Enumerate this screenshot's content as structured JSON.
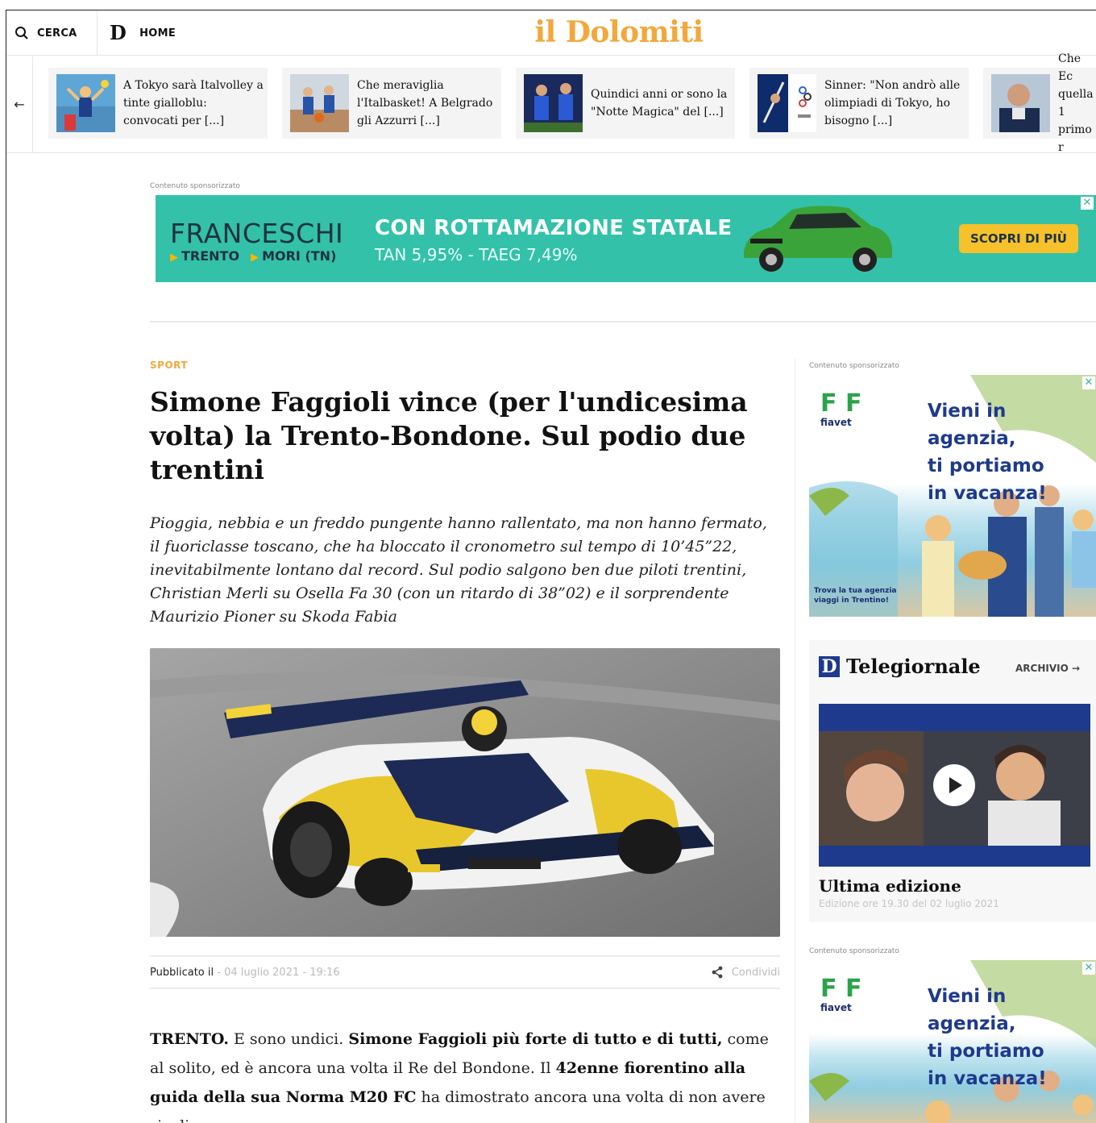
{
  "header": {
    "search_label": "CERCA",
    "home_logo": "D",
    "home_label": "HOME",
    "brand": "il Dolomiti",
    "icons": [
      "search-icon",
      "logo-d-icon"
    ]
  },
  "news_strip": {
    "back_icon": "←",
    "items": [
      {
        "text": "A Tokyo sarà Italvolley a tinte gialloblu: convocati per [...]"
      },
      {
        "text": "Che meraviglia l'Italbasket! A Belgrado gli Azzurri [...]"
      },
      {
        "text": "Quindici anni or sono la \"Notte Magica\" del [...]"
      },
      {
        "text": "Sinner: \"Non andrò alle olimpiadi di Tokyo, ho bisogno [...]"
      },
      {
        "text": "Che Ec quella 1 primo r"
      }
    ]
  },
  "banner_ad": {
    "label": "Contenuto sponsorizzato",
    "brand": "FRANCESCHI",
    "locations": [
      "TRENTO",
      "MORI (TN)"
    ],
    "headline": "CON ROTTAMAZIONE STATALE",
    "subline": "TAN 5,95% - TAEG 7,49%",
    "cta": "SCOPRI DI PIÙ",
    "close": "✕"
  },
  "article": {
    "category": "SPORT",
    "title": "Simone Faggioli vince (per l'undicesima volta) la Trento-Bondone. Sul podio due trentini",
    "lead": "Pioggia, nebbia e un freddo pungente hanno rallentato, ma non hanno fermato, il fuoriclasse toscano, che ha bloccato il cronometro sul tempo di 10’45”22, inevitabilmente lontano dal record. Sul podio salgono ben due piloti trentini, Christian Merli su Osella Fa 30 (con un ritardo di 38”02) e il sorprendente Maurizio Pioner su Skoda Fabia",
    "published_label": "Pubblicato il",
    "published_date": "- 04 luglio 2021 - 19:16",
    "share_label": "Condividi",
    "body": {
      "p1": "TRENTO.",
      "p2": " E sono undici. ",
      "p3": "Simone Faggioli più forte di tutto e di tutti,",
      "p4": " come al solito, ed è ancora una volta il Re del Bondone. Il ",
      "p5": "42enne fiorentino alla guida della sua Norma M20 FC",
      "p6": " ha dimostrato ancora una volta di non avere rivali"
    }
  },
  "sidebar": {
    "ad1": {
      "label": "Contenuto sponsorizzato",
      "brand": "F F",
      "brand_sub": "fiavet",
      "slogan_1": "Vieni in agenzia,",
      "slogan_2": "ti portiamo",
      "slogan_3": "in vacanza!",
      "small_1": "Trova la tua agenzia",
      "small_2": "viaggi in Trentino!",
      "close": "✕"
    },
    "telegiornale": {
      "logo": "D",
      "title": "Telegiornale",
      "archive": "ARCHIVIO →",
      "edition_title": "Ultima edizione",
      "edition_sub": "Edizione ore 19.30 del 02 luglio 2021"
    },
    "ad2": {
      "label": "Contenuto sponsorizzato",
      "brand": "F F",
      "brand_sub": "fiavet",
      "slogan_1": "Vieni in agenzia,",
      "slogan_2": "ti portiamo",
      "slogan_3": "in vacanza!",
      "close": "✕"
    }
  },
  "colors": {
    "brand_orange": "#f2a83b",
    "banner_teal": "#33c1a9",
    "banner_cta": "#f6c12a",
    "navy": "#1e3a8c"
  }
}
